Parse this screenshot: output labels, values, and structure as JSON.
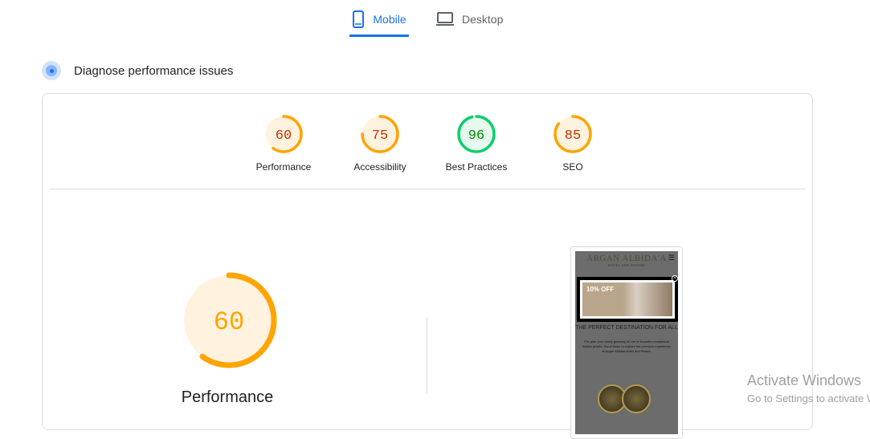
{
  "tabs": [
    {
      "label": "Mobile",
      "icon": "smartphone-icon",
      "active": true
    },
    {
      "label": "Desktop",
      "icon": "laptop-icon",
      "active": false
    }
  ],
  "section_title": "Diagnose performance issues",
  "colors": {
    "orange": "#ffa400",
    "orange_bg": "#fff3e0",
    "orange_text": "#c33300",
    "green": "#0cce6b",
    "green_bg": "#e6f9ef",
    "green_text": "#008800",
    "accent": "#1a73e8"
  },
  "scores": [
    {
      "label": "Performance",
      "value": 60,
      "value_text": "60",
      "rating": "average"
    },
    {
      "label": "Accessibility",
      "value": 75,
      "value_text": "75",
      "rating": "average"
    },
    {
      "label": "Best Practices",
      "value": 96,
      "value_text": "96",
      "rating": "pass"
    },
    {
      "label": "SEO",
      "value": 85,
      "value_text": "85",
      "rating": "average"
    }
  ],
  "main_gauge": {
    "label": "Performance",
    "value": 60,
    "value_text": "60"
  },
  "screenshot": {
    "logo": "ARGAN ALBIDA'A",
    "logo_sub": "HOTEL AND RESORT",
    "promo": "10% OFF",
    "heading": "THE PERFECT DESTINATION FOR ALL",
    "body": "Pre-plan your family getaway at one of Kuwait's exceptional hidden jewels. Scroll down to explore the premium experience at Argan Albidaa Hotel and Resort."
  },
  "watermark": {
    "line1": "Activate Windows",
    "line2": "Go to Settings to activate Windows."
  }
}
